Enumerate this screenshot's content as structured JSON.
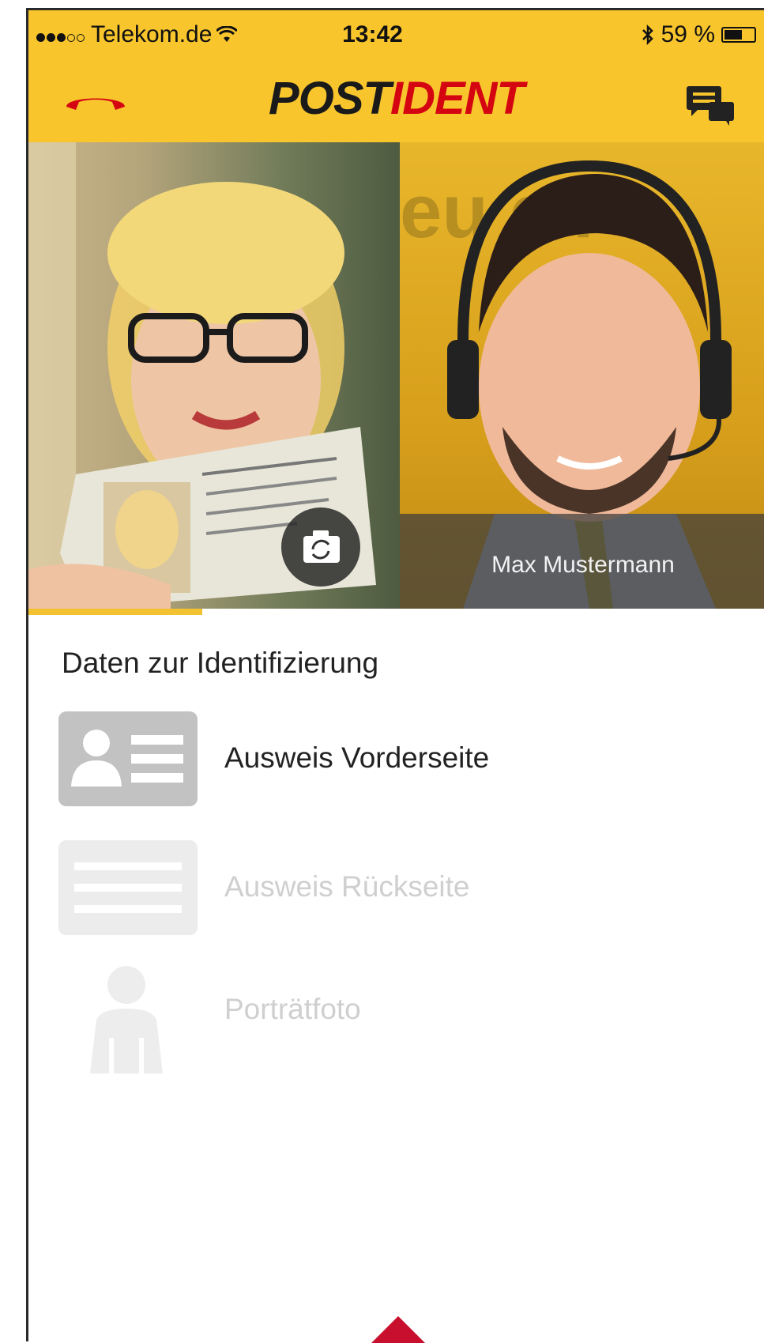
{
  "colors": {
    "yellow": "#f8c52d",
    "red": "#d40511",
    "dark": "#222222"
  },
  "status_bar": {
    "carrier": "Telekom.de",
    "time": "13:42",
    "battery": "59 %",
    "signal_dots_filled": 3,
    "signal_dots_total": 5
  },
  "navbar": {
    "title_part1": "POST",
    "title_part2": "IDENT",
    "left_icon": "hang-up-icon",
    "right_icon": "chat-icon"
  },
  "video": {
    "agent_name": "Max Mustermann",
    "swap_icon": "camera-switch-icon"
  },
  "identification": {
    "section_title": "Daten zur Identifizierung",
    "items": [
      {
        "label": "Ausweis Vorderseite",
        "icon": "id-card-front-icon",
        "active": true
      },
      {
        "label": "Ausweis Rückseite",
        "icon": "id-card-back-icon",
        "active": false
      },
      {
        "label": "Porträtfoto",
        "icon": "person-icon",
        "active": false
      }
    ]
  }
}
